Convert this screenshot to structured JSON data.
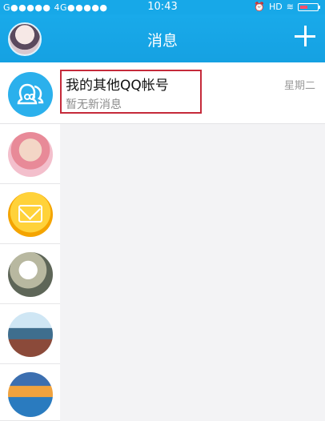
{
  "status_bar": {
    "carrier": "G●●●●● 4G●●●●●",
    "time": "10:43",
    "hd": "HD"
  },
  "header": {
    "title": "消息"
  },
  "conversations": [
    {
      "name": "我的其他QQ帐号",
      "preview": "暂无新消息",
      "time": "星期二"
    }
  ],
  "icons": {
    "header_add": "plus-icon",
    "qq_accounts": "qq-accounts-icon",
    "mail": "mail-icon"
  }
}
